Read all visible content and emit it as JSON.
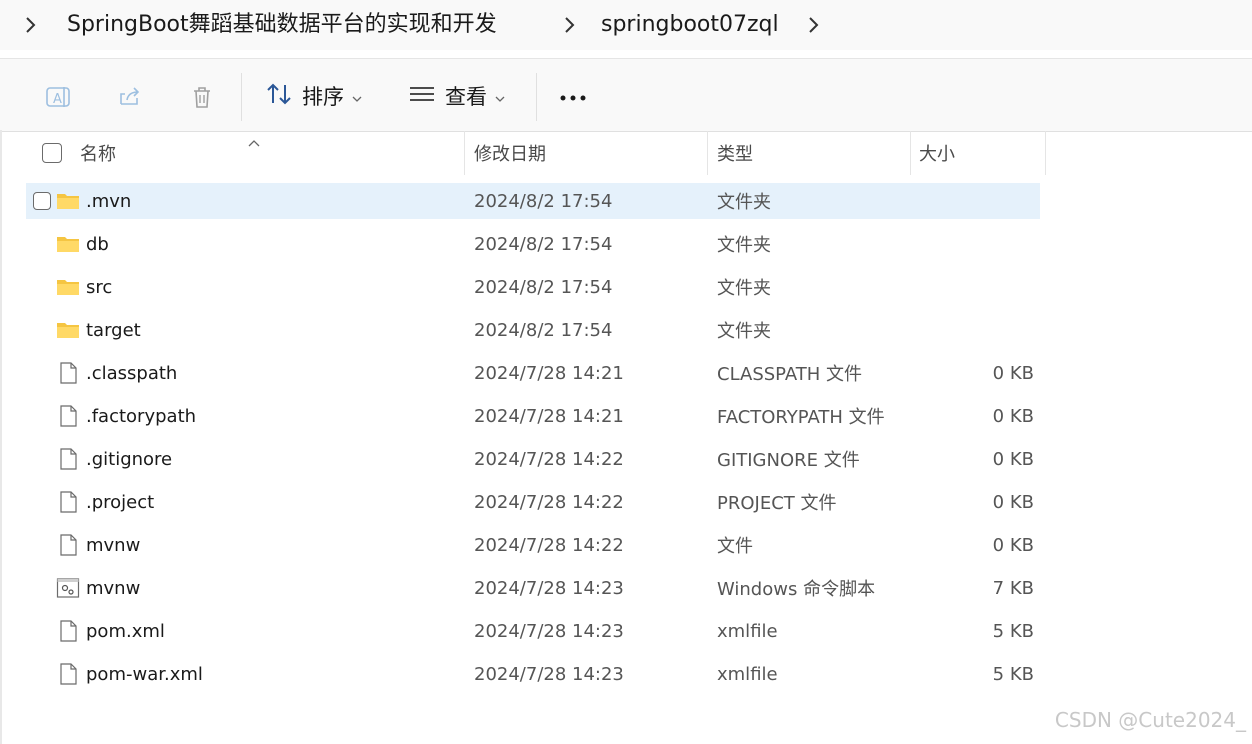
{
  "breadcrumb": {
    "items": [
      "SpringBoot舞蹈基础数据平台的实现和开发",
      "springboot07zql"
    ]
  },
  "toolbar": {
    "sort_label": "排序",
    "view_label": "查看",
    "more_label": "···"
  },
  "columns": {
    "name": "名称",
    "date": "修改日期",
    "type": "类型",
    "size": "大小"
  },
  "files": [
    {
      "name": ".mvn",
      "date": "2024/8/2 17:54",
      "type": "文件夹",
      "size": "",
      "icon": "folder-icon",
      "selected": true
    },
    {
      "name": "db",
      "date": "2024/8/2 17:54",
      "type": "文件夹",
      "size": "",
      "icon": "folder-icon"
    },
    {
      "name": "src",
      "date": "2024/8/2 17:54",
      "type": "文件夹",
      "size": "",
      "icon": "folder-icon"
    },
    {
      "name": "target",
      "date": "2024/8/2 17:54",
      "type": "文件夹",
      "size": "",
      "icon": "folder-icon"
    },
    {
      "name": ".classpath",
      "date": "2024/7/28 14:21",
      "type": "CLASSPATH 文件",
      "size": "0 KB",
      "icon": "file-icon"
    },
    {
      "name": ".factorypath",
      "date": "2024/7/28 14:21",
      "type": "FACTORYPATH 文件",
      "size": "0 KB",
      "icon": "file-icon"
    },
    {
      "name": ".gitignore",
      "date": "2024/7/28 14:22",
      "type": "GITIGNORE 文件",
      "size": "0 KB",
      "icon": "file-icon"
    },
    {
      "name": ".project",
      "date": "2024/7/28 14:22",
      "type": "PROJECT 文件",
      "size": "0 KB",
      "icon": "file-icon"
    },
    {
      "name": "mvnw",
      "date": "2024/7/28 14:22",
      "type": "文件",
      "size": "0 KB",
      "icon": "file-icon"
    },
    {
      "name": "mvnw",
      "date": "2024/7/28 14:23",
      "type": "Windows 命令脚本",
      "size": "7 KB",
      "icon": "script-icon"
    },
    {
      "name": "pom.xml",
      "date": "2024/7/28 14:23",
      "type": "xmlfile",
      "size": "5 KB",
      "icon": "file-icon"
    },
    {
      "name": "pom-war.xml",
      "date": "2024/7/28 14:23",
      "type": "xmlfile",
      "size": "5 KB",
      "icon": "file-icon"
    }
  ],
  "watermark": "CSDN @Cute2024_",
  "colors": {
    "selection": "#e5f1fb",
    "folder": "#f5c542",
    "toolbar_bg": "#f9f9f9"
  }
}
